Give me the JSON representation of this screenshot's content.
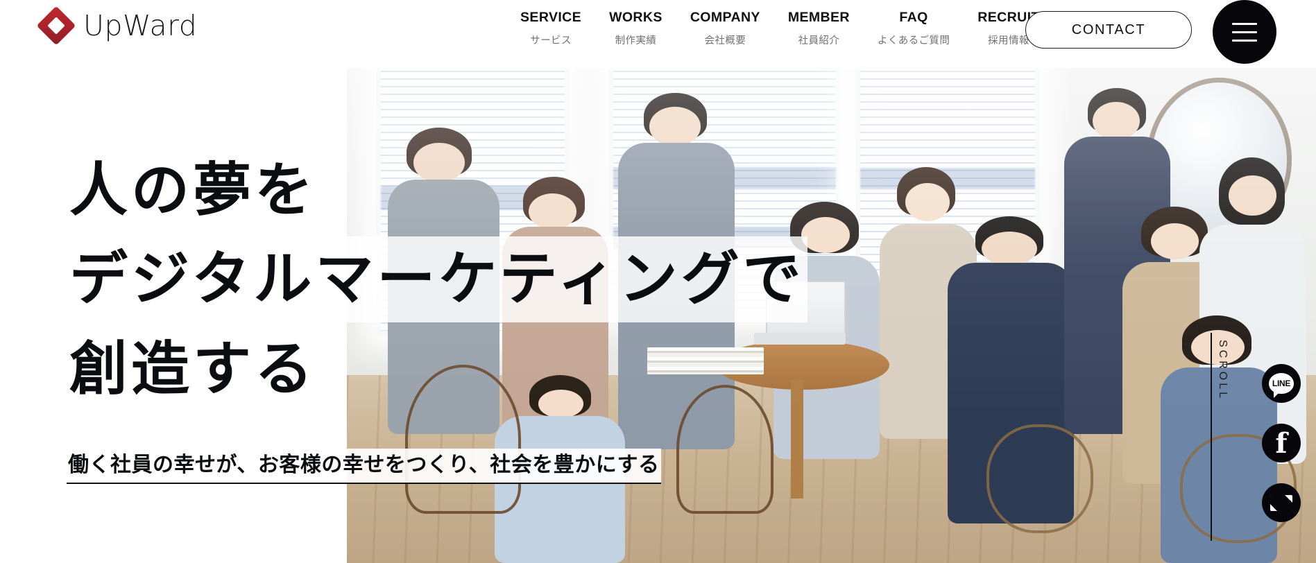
{
  "brand": {
    "name": "UpWard",
    "logo_icon": "diamond-logo-icon",
    "logo_color": "#b0222b"
  },
  "header": {
    "nav": [
      {
        "en": "SERVICE",
        "jp": "サービス"
      },
      {
        "en": "WORKS",
        "jp": "制作実績"
      },
      {
        "en": "COMPANY",
        "jp": "会社概要"
      },
      {
        "en": "MEMBER",
        "jp": "社員紹介"
      },
      {
        "en": "FAQ",
        "jp": "よくあるご質問"
      },
      {
        "en": "RECRUIT",
        "jp": "採用情報"
      }
    ],
    "contact_label": "CONTACT",
    "menu_icon": "hamburger-menu-icon"
  },
  "hero": {
    "headline_line1": "人の夢を",
    "headline_line2": "デジタルマーケティングで",
    "headline_line3": "創造する",
    "subtitle": "働く社員の幸せが、お客様の幸せをつくり、社会を豊かにする",
    "photo_alt": "オフィスで笑顔で談笑する社員チームの写真"
  },
  "side_rail": {
    "scroll_label": "SCROLL",
    "social": [
      {
        "name": "line",
        "icon": "line-icon",
        "label": "LINE"
      },
      {
        "name": "facebook",
        "icon": "facebook-icon",
        "label": "f"
      },
      {
        "name": "mail",
        "icon": "mail-icon",
        "label": ""
      }
    ]
  },
  "colors": {
    "accent_red": "#b0222b",
    "ink": "#0c0d10",
    "muted": "#6f7076",
    "black_circle": "#07070b"
  }
}
